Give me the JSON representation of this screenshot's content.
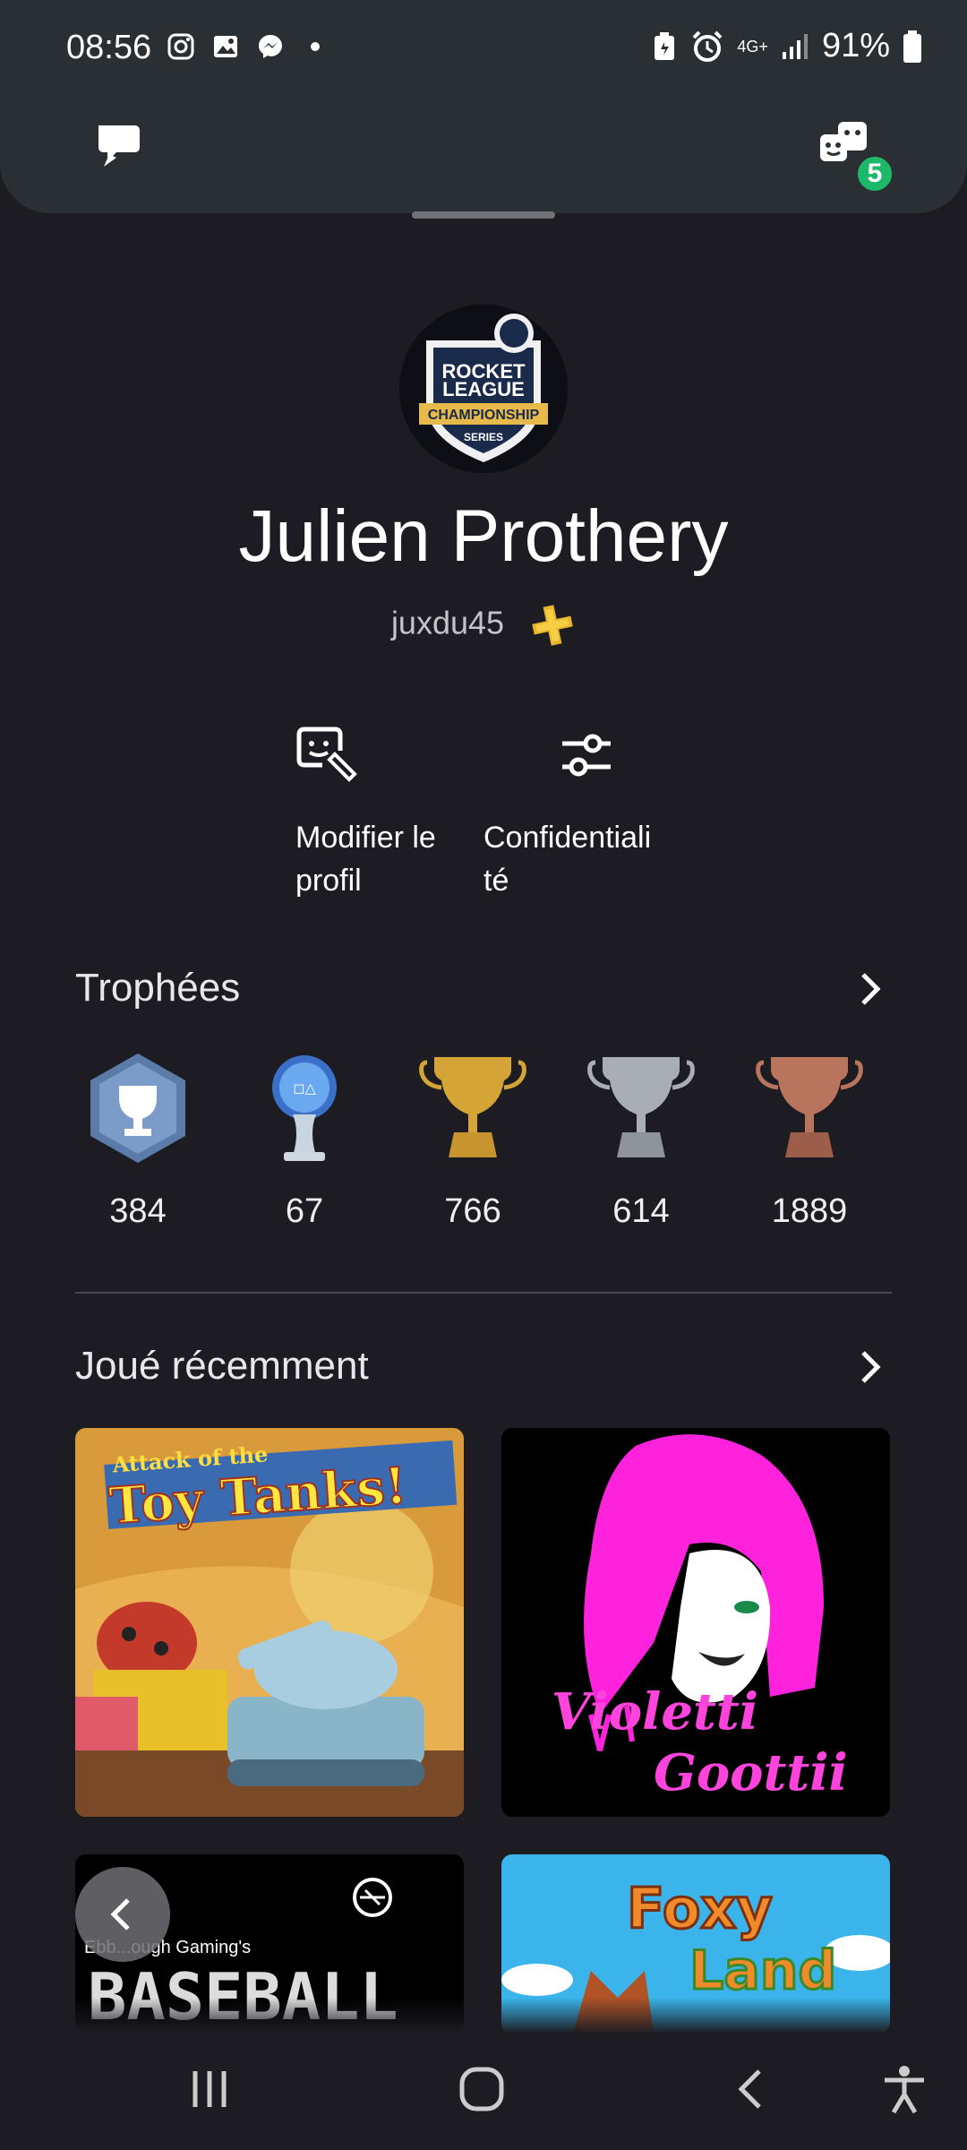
{
  "status_bar": {
    "time": "08:56",
    "network": "4G+",
    "battery": "91%"
  },
  "header": {
    "notifications_badge": "5"
  },
  "profile": {
    "display_name": "Julien Prothery",
    "online_id": "juxdu45",
    "avatar_text": [
      "ROCKET",
      "LEAGUE",
      "CHAMPIONSHIP",
      "SERIES"
    ]
  },
  "actions": {
    "edit_profile": "Modifier le profil",
    "privacy": "Confidentiali té"
  },
  "trophies": {
    "title": "Trophées",
    "items": [
      {
        "type": "level",
        "count": "384",
        "color": "#5b7ca8"
      },
      {
        "type": "platinum",
        "count": "67",
        "color": "#b8d8f0"
      },
      {
        "type": "gold",
        "count": "766",
        "color": "#d4a437"
      },
      {
        "type": "silver",
        "count": "614",
        "color": "#a9aeb4"
      },
      {
        "type": "bronze",
        "count": "1889",
        "color": "#b8745c"
      }
    ]
  },
  "recent": {
    "title": "Joué récemment",
    "games": [
      {
        "art_text_top": "Attack of the",
        "art_text_main": "Toy Tanks!"
      },
      {
        "art_text_top": "Violetti",
        "art_text_main": "Goottii"
      },
      {
        "art_text_top": "Ebb...ough Gaming's",
        "art_text_main": "BASEBALL"
      },
      {
        "art_text_top": "Foxy",
        "art_text_main": "Land"
      }
    ]
  }
}
